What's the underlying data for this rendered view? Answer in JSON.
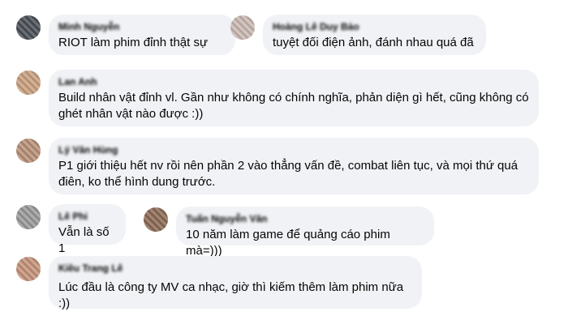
{
  "comments": [
    {
      "author": "Minh Nguyễn",
      "avatar_color": "#4a4f57",
      "text": "RIOT làm phim đỉnh thật sự"
    },
    {
      "author": "Hoàng Lê Duy Bảo",
      "avatar_color": "#c9b8b1",
      "text": "tuyệt đối điện ảnh, đánh nhau quá đã"
    },
    {
      "author": "Lan Anh",
      "avatar_color": "#c9a07f",
      "text": "Build nhân vật đỉnh vl. Gần như không có chính nghĩa, phản diện gì hết, cũng không có ghét nhân vật nào được :))"
    },
    {
      "author": "Lý Văn Hùng",
      "avatar_color": "#b89078",
      "text": "P1 giới thiệu hết nv rồi nên phần 2 vào thẳng vấn đề, combat liên tục, và mọi thứ quá điên, ko thể hình dung trước."
    },
    {
      "author": "Lê Phi",
      "avatar_color": "#9a9a9a",
      "text": "Vẫn là số 1"
    },
    {
      "author": "Tuấn Nguyễn Văn",
      "avatar_color": "#8c6a55",
      "text": "10 năm làm game để quảng cáo phim mà=)))"
    },
    {
      "author": "Kiều Trang Lê",
      "avatar_color": "#c4937a",
      "text": "Lúc đầu là công ty MV ca nhạc, giờ thì kiếm thêm làm phim nữa :))"
    }
  ]
}
